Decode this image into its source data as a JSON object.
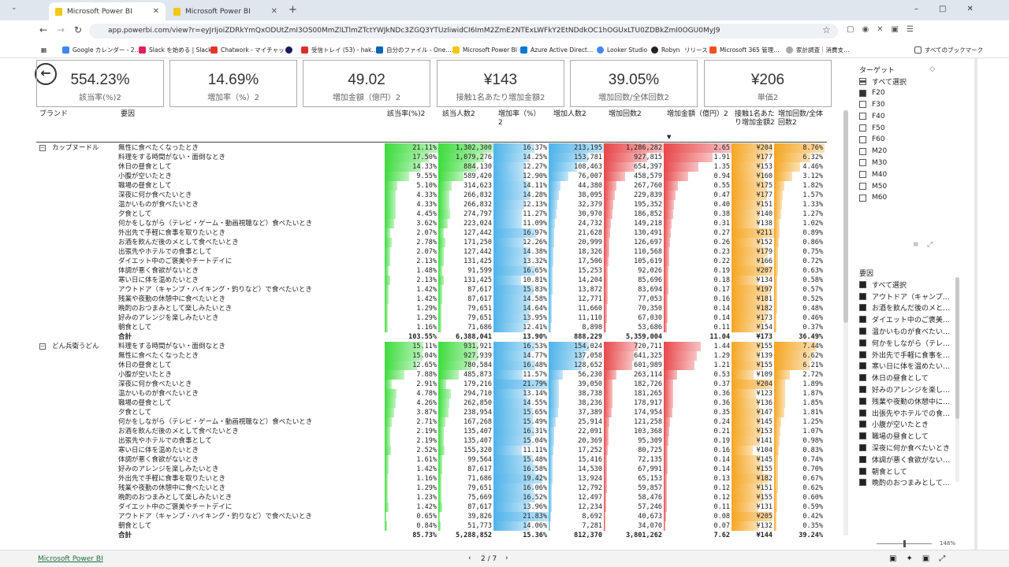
{
  "browser": {
    "tabs": [
      {
        "label": "Microsoft Power BI"
      },
      {
        "label": "Microsoft Power BI"
      }
    ],
    "url": "app.powerbi.com/view?r=eyJrIjoiZDRkYmQxODUtZmI3OS00MmZlLTlmZTctYWJkNDc3ZGQ3YTUzliwidCI6ImM2ZmE2NTExLWFkY2EtNDdkOC1hOGUxLTU0ZDBkZmI0OGU0MyJ9",
    "bookmarks": [
      "Google カレンダー - 2…",
      "Slack を始める | Slack",
      "Chatwork - マイチャット",
      "",
      "受信トレイ (53) - hak…",
      "自分のファイル - One…",
      "Microsoft Power BI",
      "Azure Active Direct…",
      "Looker Studio",
      "Robyn",
      "リリース",
      "Microsoft 365 管理…",
      "家計調査｜消費支…"
    ],
    "all_bookmarks": "すべてのブックマーク"
  },
  "cards": [
    {
      "value": "554.23%",
      "label": "該当率(%)2"
    },
    {
      "value": "14.69%",
      "label": "増加率（%）2"
    },
    {
      "value": "49.02",
      "label": "増加金額（億円）2"
    },
    {
      "value": "¥143",
      "label": "接触1名あたり増加金額2"
    },
    {
      "value": "39.05%",
      "label": "増加回数/全体回数2"
    },
    {
      "value": "¥206",
      "label": "単価2"
    }
  ],
  "table": {
    "headers": [
      "ブランド",
      "要因",
      "該当率(%)2",
      "該当人数2",
      "増加率（%）2",
      "増加人数2",
      "増加回数2",
      "増加金額（億円）2",
      "接触1名あたり増加金額2",
      "増加回数/全体回数2"
    ],
    "groups": [
      {
        "brand": "カップヌードル",
        "rows": [
          [
            "無性に食べたくなったとき",
            "21.11%",
            "1,302,300",
            "16.37%",
            "213,195",
            "1,286,282",
            "2.65",
            "¥204",
            "8.76%"
          ],
          [
            "料理をする時間がない・面倒なとき",
            "17.50%",
            "1,079,276",
            "14.25%",
            "153,781",
            "927,815",
            "1.91",
            "¥177",
            "6.32%"
          ],
          [
            "休日の昼食として",
            "14.33%",
            "884,130",
            "12.27%",
            "108,463",
            "654,397",
            "1.35",
            "¥153",
            "4.46%"
          ],
          [
            "小腹が空いたとき",
            "9.55%",
            "589,420",
            "12.90%",
            "76,007",
            "458,579",
            "0.94",
            "¥160",
            "3.12%"
          ],
          [
            "職場の昼食として",
            "5.10%",
            "314,623",
            "14.11%",
            "44,380",
            "267,760",
            "0.55",
            "¥175",
            "1.82%"
          ],
          [
            "深夜に何か食べたいとき",
            "4.33%",
            "266,832",
            "14.28%",
            "38,095",
            "229,839",
            "0.47",
            "¥177",
            "1.57%"
          ],
          [
            "温かいものが食べたいとき",
            "4.33%",
            "266,832",
            "12.13%",
            "32,379",
            "195,352",
            "0.40",
            "¥151",
            "1.33%"
          ],
          [
            "夕食として",
            "4.45%",
            "274,797",
            "11.27%",
            "30,970",
            "186,852",
            "0.38",
            "¥140",
            "1.27%"
          ],
          [
            "何かをしながら（テレビ・ゲーム・動画視聴など）食べたいとき",
            "3.62%",
            "223,024",
            "11.09%",
            "24,732",
            "149,218",
            "0.31",
            "¥138",
            "1.02%"
          ],
          [
            "外出先で手軽に食事を取りたいとき",
            "2.07%",
            "127,442",
            "16.97%",
            "21,628",
            "130,491",
            "0.27",
            "¥211",
            "0.89%"
          ],
          [
            "お酒を飲んだ後のメとして食べたいとき",
            "2.78%",
            "171,250",
            "12.26%",
            "20,999",
            "126,697",
            "0.26",
            "¥152",
            "0.86%"
          ],
          [
            "出張先やホテルでの食事として",
            "2.07%",
            "127,442",
            "14.38%",
            "18,326",
            "110,568",
            "0.23",
            "¥179",
            "0.75%"
          ],
          [
            "ダイエット中のご褒美やチートデイに",
            "2.13%",
            "131,425",
            "13.32%",
            "17,506",
            "105,619",
            "0.22",
            "¥166",
            "0.72%"
          ],
          [
            "体調が悪く食欲がないとき",
            "1.48%",
            "91,599",
            "16.65%",
            "15,253",
            "92,026",
            "0.19",
            "¥207",
            "0.63%"
          ],
          [
            "寒い日に体を温めたいとき",
            "2.13%",
            "131,425",
            "10.81%",
            "14,204",
            "85,696",
            "0.18",
            "¥134",
            "0.58%"
          ],
          [
            "アウトドア（キャンプ・ハイキング・釣りなど）で食べたいとき",
            "1.42%",
            "87,617",
            "15.83%",
            "13,872",
            "83,694",
            "0.17",
            "¥197",
            "0.57%"
          ],
          [
            "残業や夜勤の休憩中に食べたいとき",
            "1.42%",
            "87,617",
            "14.58%",
            "12,771",
            "77,053",
            "0.16",
            "¥181",
            "0.52%"
          ],
          [
            "晩酌のおつまみとして楽しみたいとき",
            "1.29%",
            "79,651",
            "14.64%",
            "11,660",
            "70,350",
            "0.14",
            "¥182",
            "0.48%"
          ],
          [
            "好みのアレンジを楽しみたいとき",
            "1.29%",
            "79,651",
            "13.95%",
            "11,110",
            "67,030",
            "0.14",
            "¥173",
            "0.46%"
          ],
          [
            "朝食として",
            "1.16%",
            "71,686",
            "12.41%",
            "8,898",
            "53,686",
            "0.11",
            "¥154",
            "0.37%"
          ]
        ],
        "total": [
          "合計",
          "103.55%",
          "6,388,041",
          "13.90%",
          "888,229",
          "5,359,004",
          "11.04",
          "¥173",
          "36.49%"
        ]
      },
      {
        "brand": "どん兵衛うどん",
        "rows": [
          [
            "料理をする時間がない・面倒なとき",
            "15.11%",
            "931,921",
            "16.53%",
            "154,024",
            "720,711",
            "1.44",
            "¥155",
            "7.44%"
          ],
          [
            "無性に食べたくなったとき",
            "15.04%",
            "927,939",
            "14.77%",
            "137,058",
            "641,325",
            "1.29",
            "¥139",
            "6.62%"
          ],
          [
            "休日の昼食として",
            "12.65%",
            "780,584",
            "16.48%",
            "128,652",
            "601,989",
            "1.21",
            "¥155",
            "6.21%"
          ],
          [
            "小腹が空いたとき",
            "7.88%",
            "485,873",
            "11.57%",
            "56,230",
            "263,114",
            "0.53",
            "¥109",
            "2.72%"
          ],
          [
            "深夜に何か食べたいとき",
            "2.91%",
            "179,216",
            "21.79%",
            "39,050",
            "182,726",
            "0.37",
            "¥204",
            "1.89%"
          ],
          [
            "温かいものが食べたいとき",
            "4.78%",
            "294,710",
            "13.14%",
            "38,738",
            "181,265",
            "0.36",
            "¥123",
            "1.87%"
          ],
          [
            "職場の昼食として",
            "4.26%",
            "262,850",
            "14.55%",
            "38,236",
            "178,917",
            "0.36",
            "¥136",
            "1.85%"
          ],
          [
            "夕食として",
            "3.87%",
            "238,954",
            "15.65%",
            "37,389",
            "174,954",
            "0.35",
            "¥147",
            "1.81%"
          ],
          [
            "何かをしながら（テレビ・ゲーム・動画視聴など）食べたいとき",
            "2.71%",
            "167,268",
            "15.49%",
            "25,914",
            "121,258",
            "0.24",
            "¥145",
            "1.25%"
          ],
          [
            "お酒を飲んだ後のメとして食べたいとき",
            "2.19%",
            "135,407",
            "16.31%",
            "22,091",
            "103,368",
            "0.21",
            "¥153",
            "1.07%"
          ],
          [
            "出張先やホテルでの食事として",
            "2.19%",
            "135,407",
            "15.04%",
            "20,369",
            "95,309",
            "0.19",
            "¥141",
            "0.98%"
          ],
          [
            "寒い日に体を温めたいとき",
            "2.52%",
            "155,320",
            "11.11%",
            "17,252",
            "80,725",
            "0.16",
            "¥104",
            "0.83%"
          ],
          [
            "体調が悪く食欲がないとき",
            "1.61%",
            "99,564",
            "15.48%",
            "15,416",
            "72,135",
            "0.14",
            "¥145",
            "0.74%"
          ],
          [
            "好みのアレンジを楽しみたいとき",
            "1.42%",
            "87,617",
            "16.58%",
            "14,530",
            "67,991",
            "0.14",
            "¥155",
            "0.70%"
          ],
          [
            "外出先で手軽に食事を取りたいとき",
            "1.16%",
            "71,686",
            "19.42%",
            "13,924",
            "65,153",
            "0.13",
            "¥182",
            "0.67%"
          ],
          [
            "残業や夜勤の休憩中に食べたいとき",
            "1.29%",
            "79,651",
            "16.06%",
            "12,792",
            "59,857",
            "0.12",
            "¥151",
            "0.62%"
          ],
          [
            "晩酌のおつまみとして楽しみたいとき",
            "1.23%",
            "75,669",
            "16.52%",
            "12,497",
            "58,476",
            "0.12",
            "¥155",
            "0.60%"
          ],
          [
            "ダイエット中のご褒美やチートデイに",
            "1.42%",
            "87,617",
            "13.96%",
            "12,234",
            "57,246",
            "0.11",
            "¥131",
            "0.59%"
          ],
          [
            "アウトドア（キャンプ・ハイキング・釣りなど）で食べたいとき",
            "0.65%",
            "39,826",
            "21.83%",
            "8,692",
            "40,673",
            "0.08",
            "¥205",
            "0.42%"
          ],
          [
            "朝食として",
            "0.84%",
            "51,773",
            "14.06%",
            "7,281",
            "34,070",
            "0.07",
            "¥132",
            "0.35%"
          ]
        ],
        "total": [
          "合計",
          "85.73%",
          "5,288,852",
          "15.36%",
          "812,370",
          "3,801,262",
          "7.62",
          "¥144",
          "39.24%"
        ]
      }
    ]
  },
  "slicer_target": {
    "title": "ターゲット",
    "items": [
      "すべて選択",
      "F20",
      "F30",
      "F40",
      "F50",
      "F60",
      "M20",
      "M30",
      "M40",
      "M50",
      "M60"
    ],
    "checked": [
      false,
      true,
      false,
      false,
      false,
      false,
      false,
      false,
      false,
      false,
      false
    ]
  },
  "slicer_factor": {
    "title": "要因",
    "items": [
      "すべて選択",
      "アウトドア（キャンプ…",
      "お酒を飲んだ後のメと…",
      "ダイエット中のご褒美…",
      "温かいものが食べたい…",
      "何かをしながら（テレ…",
      "外出先で手軽に食事を…",
      "寒い日に体を温めたい…",
      "休日の昼食として",
      "好みのアレンジを楽し…",
      "残業や夜勤の休憩中に…",
      "出張先やホテルでの食…",
      "小腹が空いたとき",
      "職場の昼食として",
      "深夜に何か食べたいとき",
      "体調が悪く食欲がない…",
      "朝食として",
      "晩酌のおつまみとして…"
    ]
  },
  "footer": {
    "brand": "Microsoft Power BI",
    "page": "2 / 7",
    "zoom": "148%"
  },
  "colors": {
    "green": "#3ddc3d",
    "blue": "#4fb3ea",
    "red": "#e8484a",
    "orange": "#f5a623"
  }
}
